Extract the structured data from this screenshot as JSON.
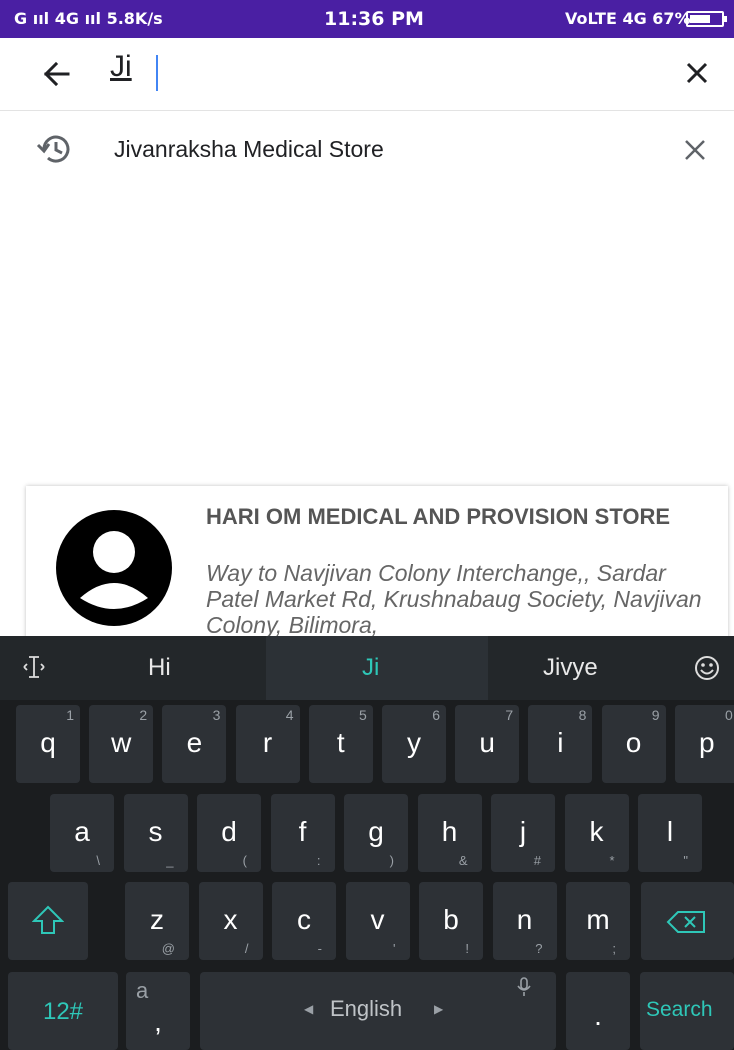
{
  "status_bar": {
    "left": "G ııl 4G ııl 5.8K/s",
    "time": "11:36 PM",
    "right": "VoLTE 4G 67%",
    "battery_level": 0.67
  },
  "search": {
    "query": "Ji"
  },
  "history": [
    {
      "label": "Jivanraksha Medical Store"
    }
  ],
  "result_card": {
    "title": "HARI OM MEDICAL AND PROVISION STORE",
    "address": "Way to Navjivan Colony Interchange,, Sardar Patel Market Rd, Krushnabaug Society, Navjivan Colony, Bilimora,"
  },
  "keyboard": {
    "suggestions": [
      "Hi",
      "Ji",
      "Jivye"
    ],
    "row1": [
      {
        "k": "q",
        "n": "1"
      },
      {
        "k": "w",
        "n": "2"
      },
      {
        "k": "e",
        "n": "3"
      },
      {
        "k": "r",
        "n": "4"
      },
      {
        "k": "t",
        "n": "5"
      },
      {
        "k": "y",
        "n": "6"
      },
      {
        "k": "u",
        "n": "7"
      },
      {
        "k": "i",
        "n": "8"
      },
      {
        "k": "o",
        "n": "9"
      },
      {
        "k": "p",
        "n": "0"
      }
    ],
    "row2": [
      {
        "k": "a",
        "s": "\\"
      },
      {
        "k": "s",
        "s": "_"
      },
      {
        "k": "d",
        "s": "("
      },
      {
        "k": "f",
        "s": ":"
      },
      {
        "k": "g",
        "s": ")"
      },
      {
        "k": "h",
        "s": "&"
      },
      {
        "k": "j",
        "s": "#"
      },
      {
        "k": "k",
        "s": "*"
      },
      {
        "k": "l",
        "s": "\""
      }
    ],
    "row3": [
      {
        "k": "z",
        "s": "@"
      },
      {
        "k": "x",
        "s": "/"
      },
      {
        "k": "c",
        "s": "-"
      },
      {
        "k": "v",
        "s": "'"
      },
      {
        "k": "b",
        "s": "!"
      },
      {
        "k": "n",
        "s": "?"
      },
      {
        "k": "m",
        "s": ";"
      }
    ],
    "symbols_label": "12#",
    "comma_main": ",",
    "comma_alt": "a",
    "space_label": "English",
    "period_label": ".",
    "action_label": "Search",
    "accent_color": "#2ec7b8"
  }
}
